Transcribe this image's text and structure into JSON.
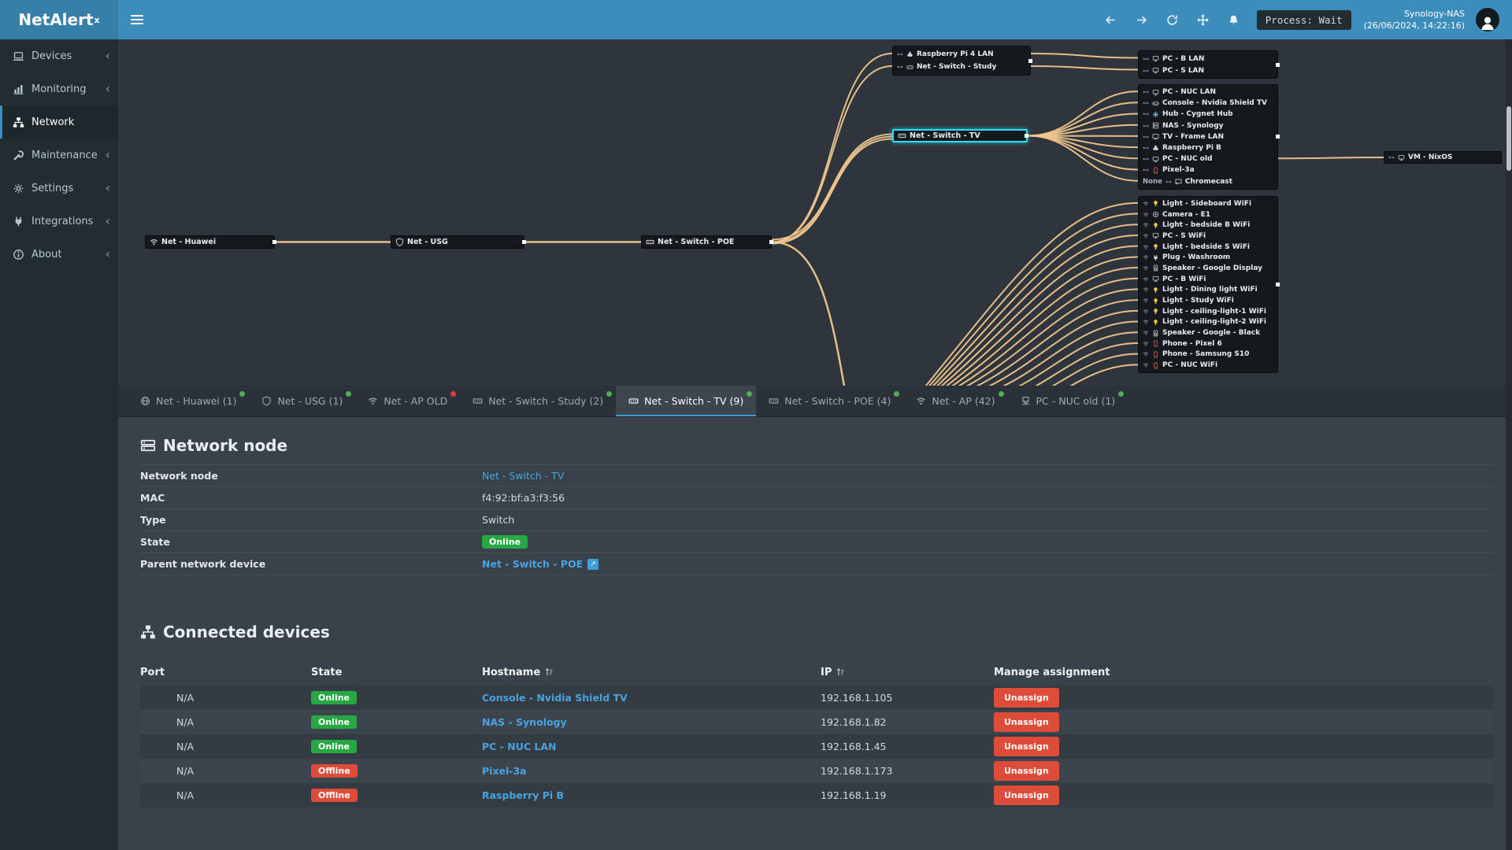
{
  "colors": {
    "accent": "#3c8dbc",
    "link_orange": "#f0c68c",
    "selected_cyan": "#29e0f2",
    "online": "#28a745",
    "offline": "#dd4b39",
    "link_blue": "#4aa3df",
    "dot_green": "#4caf50",
    "dot_red": "#e53935"
  },
  "header": {
    "brand": "NetAlert",
    "brand_sup": "x",
    "process_label": "Process: Wait",
    "server_name": "Synology-NAS",
    "server_time": "(26/06/2024, 14:22:16)"
  },
  "sidebar": {
    "items": [
      {
        "label": "Devices",
        "icon": "devices-icon",
        "chevron": true
      },
      {
        "label": "Monitoring",
        "icon": "monitoring-icon",
        "chevron": true
      },
      {
        "label": "Network",
        "icon": "network-icon",
        "active": true
      },
      {
        "label": "Maintenance",
        "icon": "maintenance-icon",
        "chevron": true
      },
      {
        "label": "Settings",
        "icon": "settings-icon",
        "chevron": true
      },
      {
        "label": "Integrations",
        "icon": "integrations-icon",
        "chevron": true
      },
      {
        "label": "About",
        "icon": "about-icon",
        "chevron": true
      }
    ]
  },
  "diagram": {
    "chain": [
      {
        "id": "huawei",
        "label": "Net - Huawei",
        "icon": "wifi-icon"
      },
      {
        "id": "usg",
        "label": "Net - USG",
        "icon": "shield-icon"
      },
      {
        "id": "poe",
        "label": "Net - Switch - POE",
        "icon": "switch-icon"
      },
      {
        "id": "tv",
        "label": "Net - Switch - TV",
        "icon": "switch-icon",
        "selected": true
      }
    ],
    "top_box": [
      {
        "label": "Raspberry Pi 4 LAN",
        "icon": "pi-icon"
      },
      {
        "label": "Net - Switch - Study",
        "icon": "switch-icon"
      }
    ],
    "top_right_box": [
      {
        "label": "PC - B LAN",
        "icon": "pc-icon"
      },
      {
        "label": "PC - S LAN",
        "icon": "pc-icon"
      }
    ],
    "tv_cluster": [
      {
        "label": "PC - NUC LAN",
        "icon": "pc-icon"
      },
      {
        "label": "Console - Nvidia Shield TV",
        "icon": "console-icon"
      },
      {
        "label": "Hub - Cygnet Hub",
        "icon": "hub-icon"
      },
      {
        "label": "NAS - Synology",
        "icon": "nas-icon"
      },
      {
        "label": "TV - Frame LAN",
        "icon": "tv-icon"
      },
      {
        "label": "Raspberry Pi B",
        "icon": "pi-icon"
      },
      {
        "label": "PC - NUC old",
        "icon": "pc-icon"
      },
      {
        "label": "Pixel-3a",
        "icon": "phone-icon"
      },
      {
        "label": "Chromecast",
        "icon": "cast-icon",
        "prefix": "None"
      }
    ],
    "wifi_cluster": [
      {
        "label": "Light - Sideboard WiFi",
        "icon": "bulb-icon"
      },
      {
        "label": "Camera - E1",
        "icon": "camera-icon"
      },
      {
        "label": "Light - bedside B WiFi",
        "icon": "bulb-icon"
      },
      {
        "label": "PC - S WiFi",
        "icon": "pc-icon"
      },
      {
        "label": "Light - bedside S WiFi",
        "icon": "bulb-icon"
      },
      {
        "label": "Plug - Washroom",
        "icon": "plug-icon"
      },
      {
        "label": "Speaker - Google Display",
        "icon": "speaker-icon"
      },
      {
        "label": "PC - B WiFi",
        "icon": "pc-icon"
      },
      {
        "label": "Light - Dining light WiFi",
        "icon": "bulb-icon"
      },
      {
        "label": "Light - Study WiFi",
        "icon": "bulb-icon"
      },
      {
        "label": "Light - ceiling-light-1 WiFi",
        "icon": "bulb-icon"
      },
      {
        "label": "Light - ceiling-light-2 WiFi",
        "icon": "bulb-icon"
      },
      {
        "label": "Speaker - Google - Black",
        "icon": "speaker-icon"
      },
      {
        "label": "Phone - Pixel 6",
        "icon": "phone-icon"
      },
      {
        "label": "Phone - Samsung S10",
        "icon": "phone-icon"
      },
      {
        "label": "PC - NUC WiFi",
        "icon": "phone-icon"
      }
    ],
    "vm": {
      "label": "VM - NixOS",
      "icon": "pc-icon"
    }
  },
  "tabs": [
    {
      "label": "Net - Huawei (1)",
      "icon": "globe-icon",
      "dot": "green"
    },
    {
      "label": "Net - USG (1)",
      "icon": "shield-icon",
      "dot": "green"
    },
    {
      "label": "Net - AP OLD",
      "icon": "wifi-icon",
      "dot": "red"
    },
    {
      "label": "Net - Switch - Study (2)",
      "icon": "switch-icon",
      "dot": "green"
    },
    {
      "label": "Net - Switch - TV (9)",
      "icon": "switch-icon",
      "dot": "green",
      "active": true
    },
    {
      "label": "Net - Switch - POE (4)",
      "icon": "switch-icon",
      "dot": "green"
    },
    {
      "label": "Net - AP (42)",
      "icon": "wifi-icon",
      "dot": "green"
    },
    {
      "label": "PC - NUC old (1)",
      "icon": "ethernet-icon",
      "dot": "green"
    }
  ],
  "node_panel": {
    "title": "Network node",
    "fields": [
      {
        "label": "Network node",
        "value": "Net - Switch - TV",
        "type": "link"
      },
      {
        "label": "MAC",
        "value": "f4:92:bf:a3:f3:56",
        "type": "text"
      },
      {
        "label": "Type",
        "value": "Switch",
        "type": "text"
      },
      {
        "label": "State",
        "value": "Online",
        "type": "badge"
      },
      {
        "label": "Parent network device",
        "value": "Net - Switch - POE",
        "type": "link-ext"
      }
    ]
  },
  "devices_panel": {
    "title": "Connected devices",
    "columns": [
      {
        "label": "Port"
      },
      {
        "label": "State"
      },
      {
        "label": "Hostname",
        "sortable": true
      },
      {
        "label": "IP",
        "sortable": true
      },
      {
        "label": "Manage assignment"
      }
    ],
    "unassign_label": "Unassign",
    "rows": [
      {
        "port": "N/A",
        "state": "Online",
        "hostname": "Console - Nvidia Shield TV",
        "ip": "192.168.1.105"
      },
      {
        "port": "N/A",
        "state": "Online",
        "hostname": "NAS - Synology",
        "ip": "192.168.1.82"
      },
      {
        "port": "N/A",
        "state": "Online",
        "hostname": "PC - NUC LAN",
        "ip": "192.168.1.45"
      },
      {
        "port": "N/A",
        "state": "Offline",
        "hostname": "Pixel-3a",
        "ip": "192.168.1.173"
      },
      {
        "port": "N/A",
        "state": "Offline",
        "hostname": "Raspberry Pi B",
        "ip": "192.168.1.19"
      }
    ]
  }
}
